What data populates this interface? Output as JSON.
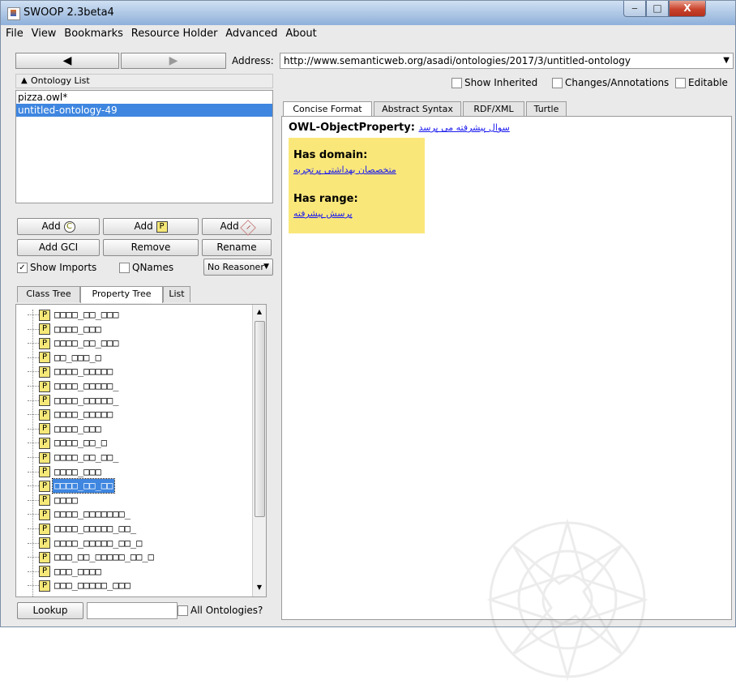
{
  "window": {
    "title": "SWOOP 2.3beta4",
    "min": "‒",
    "max": "□",
    "close": "X"
  },
  "menu": [
    "File",
    "View",
    "Bookmarks",
    "Resource Holder",
    "Advanced",
    "About"
  ],
  "toolbar": {
    "back_glyph": "◀",
    "fwd_glyph": "▶",
    "address_label": "Address:",
    "address_value": "http://www.semanticweb.org/asadi/ontologies/2017/3/untitled-ontology",
    "dropdown_glyph": "▼"
  },
  "ontology_list": {
    "header": "Ontology List",
    "items": [
      "pizza.owl*",
      "untitled-ontology-49"
    ],
    "selected_index": 1
  },
  "buttons": {
    "add_class": "Add",
    "add_class_icon": "C",
    "add_prop": "Add",
    "add_prop_icon": "P",
    "add_ind": "Add",
    "add_ind_icon": "I",
    "add_gci": "Add GCI",
    "remove": "Remove",
    "rename": "Rename",
    "show_imports": "Show Imports",
    "qnames": "QNames",
    "reasoner": "No Reasoner",
    "lookup": "Lookup",
    "all_ontologies": "All Ontologies?"
  },
  "checks": {
    "show_imports": true,
    "qnames": false,
    "all_ontologies": false
  },
  "left_tabs": [
    "Class Tree",
    "Property Tree",
    "List"
  ],
  "left_tab_active": 1,
  "property_tree": {
    "icon_letter": "P",
    "rows": [
      "□□□□_□□_□□□",
      "□□□□_□□□",
      "□□□□_□□_□□□",
      "□□_□□□_□",
      "□□□□_□□□□□",
      "□□□□_□□□□□_",
      "□□□□_□□□□□_",
      "□□□□_□□□□□",
      "□□□□_□□□",
      "□□□□_□□_□",
      "□□□□_□□_□□_",
      "□□□□_□□□",
      "□□□□_□□_□□",
      "□□□□",
      "□□□□_□□□□□□□_",
      "□□□□_□□□□□_□□_",
      "□□□□_□□□□□_□□_□",
      "□□□_□□_□□□□□_□□_□",
      "□□□_□□□□",
      "□□□_□□□□□_□□□"
    ],
    "selected_index": 12
  },
  "right_options": {
    "show_inherited": "Show Inherited",
    "changes": "Changes/Annotations",
    "editable": "Editable"
  },
  "right_tabs": [
    "Concise Format",
    "Abstract Syntax",
    "RDF/XML",
    "Turtle"
  ],
  "right_tab_active": 0,
  "entity": {
    "type_label": "OWL-ObjectProperty:",
    "name": "سوال پیشرفته می پرسد",
    "domain_label": "Has domain:",
    "domain_value": "متخصصان بهداشتی پرتجربه",
    "range_label": "Has range:",
    "range_value": "پرسش پیشرفته"
  }
}
